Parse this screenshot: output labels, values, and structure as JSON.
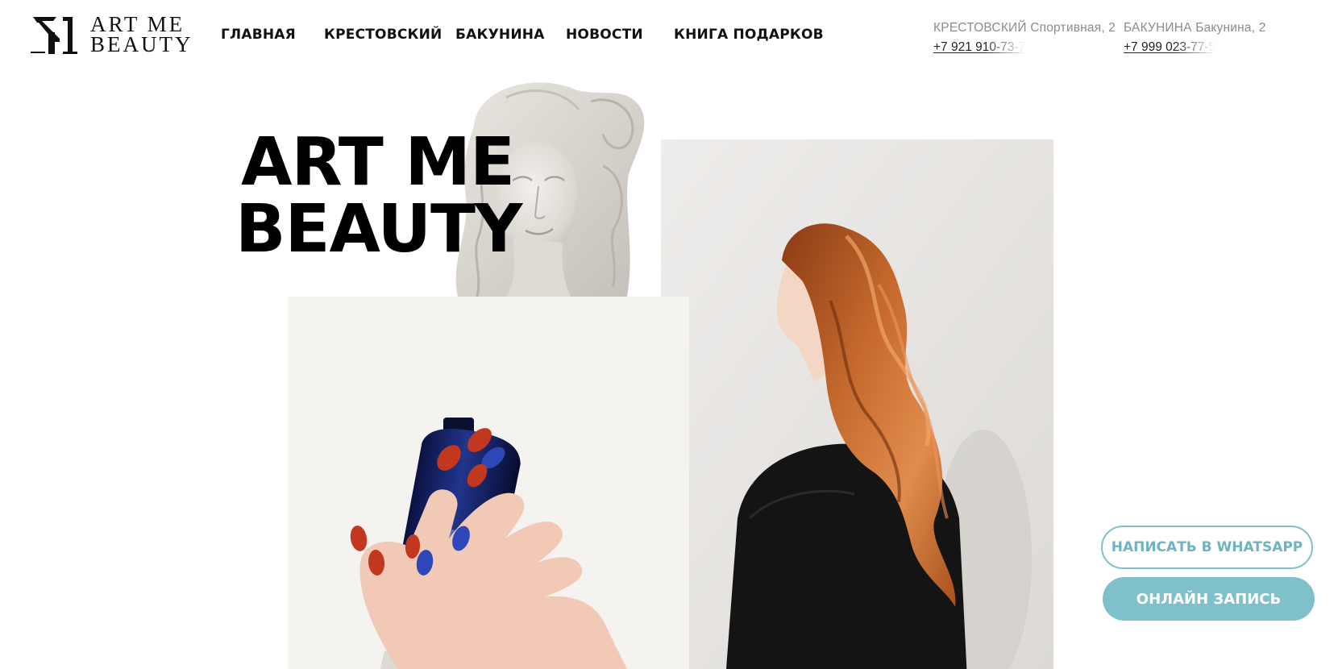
{
  "logo": {
    "line1": "ART ME",
    "line2": "BEAUTY"
  },
  "nav": {
    "items": [
      {
        "label": "ГЛАВНАЯ"
      },
      {
        "label": "КРЕСТОВСКИЙ"
      },
      {
        "label": "БАКУНИНА"
      },
      {
        "label": "НОВОСТИ"
      },
      {
        "label": "КНИГА ПОДАРКОВ"
      }
    ]
  },
  "contacts": [
    {
      "address": "КРЕСТОВСКИЙ Спортивная, 2",
      "phone": "+7 921 910-73-7"
    },
    {
      "address": "БАКУНИНА Бакунина, 2",
      "phone": "+7 999 023-77-5"
    }
  ],
  "hero": {
    "title_line1": "ART ME",
    "title_line2": "BEAUTY"
  },
  "cta": {
    "whatsapp_label": "НАПИСАТЬ В WHATSAPP",
    "booking_label": "ОНЛАЙН ЗАПИСЬ"
  },
  "colors": {
    "accent": "#7fc0cb",
    "text": "#111111",
    "muted": "#8c8c8c",
    "background": "#ffffff"
  },
  "icons": {
    "logo_mark": "am-monogram-logo-icon"
  }
}
